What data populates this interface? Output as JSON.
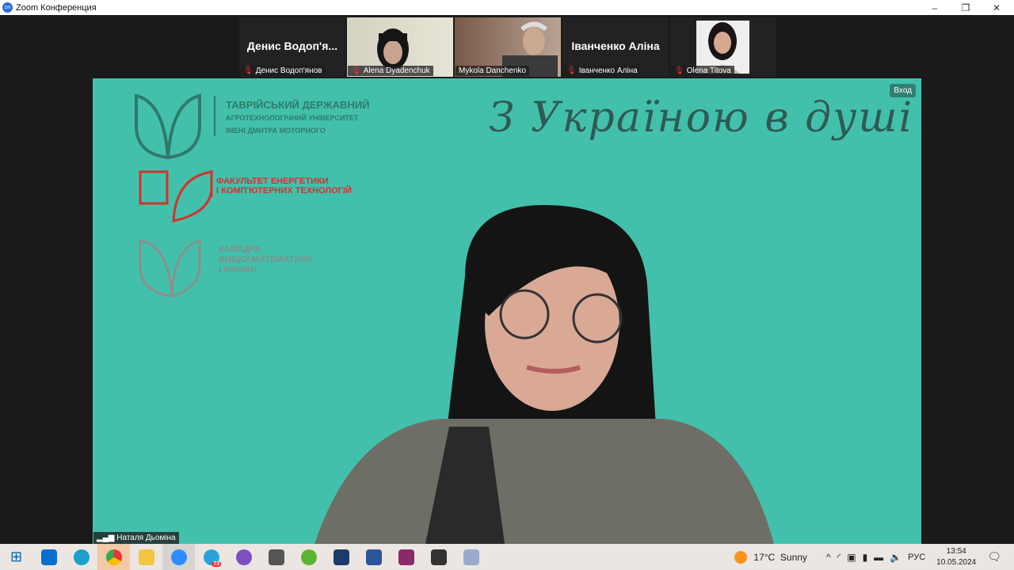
{
  "window": {
    "title": "Zoom Конференция",
    "app_icon": "zm"
  },
  "participants": [
    {
      "big_name": "Денис Водоп'я...",
      "label": "Денис Водоп'янов",
      "muted": true
    },
    {
      "big_name": "",
      "label": "Alena Dyadenchuk",
      "muted": true
    },
    {
      "big_name": "",
      "label": "Mykola Danchenko",
      "muted": false
    },
    {
      "big_name": "Іванченко Аліна",
      "label": "Іванченко Аліна",
      "muted": true
    },
    {
      "big_name": "",
      "label": "Olena Titova",
      "muted": true
    }
  ],
  "main": {
    "enter_button": "Вход",
    "speaker": "Наталя Дьоміна",
    "logo1": [
      "ТАВРІЙСЬКИЙ ДЕРЖАВНИЙ",
      "АГРОТЕХНОЛОГІЧНИЙ УНІВЕРСИТЕТ",
      "ІМЕНІ ДМИТРА МОТОРНОГО"
    ],
    "logo2": [
      "ФАКУЛЬТЕТ ЕНЕРГЕТИКИ",
      "І КОМП'ЮТЕРНИХ ТЕХНОЛОГІЙ"
    ],
    "logo3": [
      "КАФЕДРА",
      "ВИЩОЇ МАТЕМАТИКИ",
      "І ФІЗИКИ"
    ],
    "motto": "З Україною в душі"
  },
  "taskbar": {
    "weather": "17°C  Sunny",
    "lang": "РУС",
    "time": "13:54",
    "date": "10.05.2024",
    "telegram_badge": "73"
  },
  "colors": {
    "background": "#43c0ab",
    "brand_red": "#d0332e"
  }
}
